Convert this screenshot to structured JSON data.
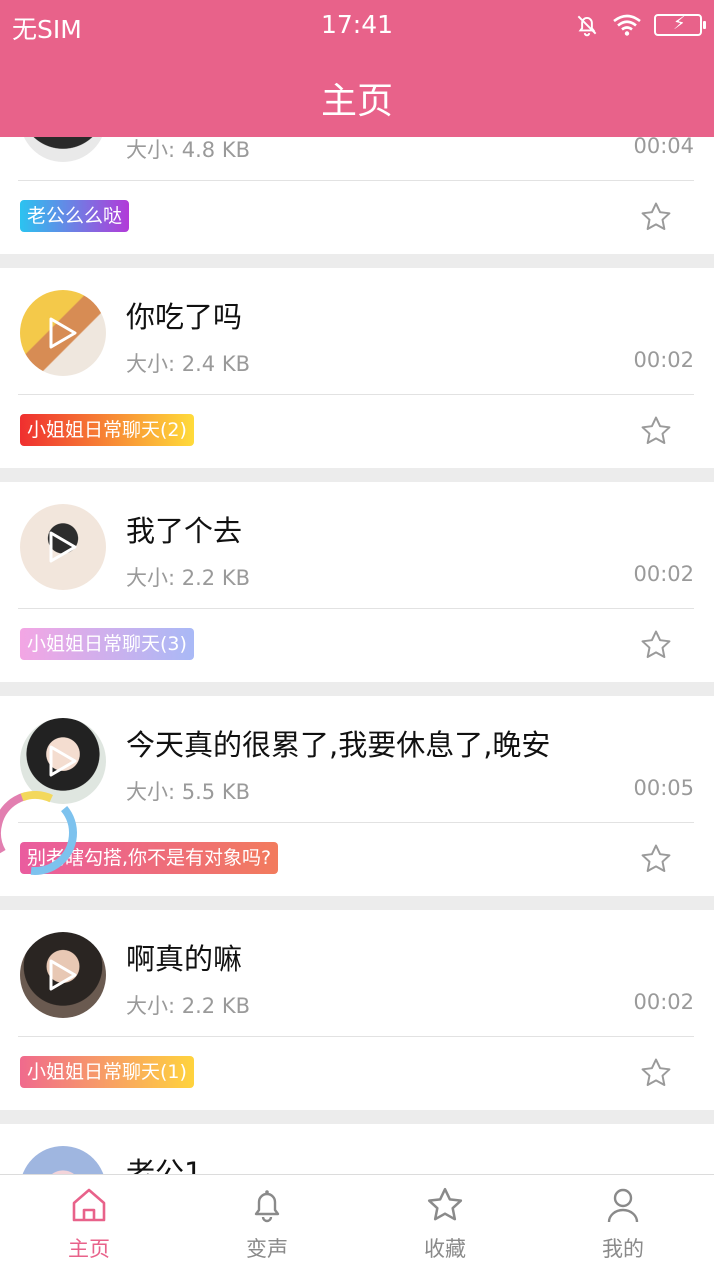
{
  "status": {
    "carrier": "无SIM",
    "time": "17:41"
  },
  "header": {
    "title": "主页"
  },
  "colors": {
    "brand": "#e8628a",
    "active_tab": "#e8628a"
  },
  "items": [
    {
      "name": "",
      "size": "大小: 4.8 KB",
      "duration": "00:04",
      "tag": "老公么么哒"
    },
    {
      "name": "你吃了吗",
      "size": "大小: 2.4 KB",
      "duration": "00:02",
      "tag": "小姐姐日常聊天(2)"
    },
    {
      "name": "我了个去",
      "size": "大小: 2.2 KB",
      "duration": "00:02",
      "tag": "小姐姐日常聊天(3)"
    },
    {
      "name": "今天真的很累了,我要休息了,晚安",
      "size": "大小: 5.5 KB",
      "duration": "00:05",
      "tag": "别老瞎勾搭,你不是有对象吗?"
    },
    {
      "name": "啊真的嘛",
      "size": "大小: 2.2 KB",
      "duration": "00:02",
      "tag": "小姐姐日常聊天(1)"
    },
    {
      "name": "老公1"
    }
  ],
  "tabs": [
    {
      "label": "主页",
      "icon": "home-icon",
      "active": true
    },
    {
      "label": "变声",
      "icon": "bell-icon"
    },
    {
      "label": "收藏",
      "icon": "star-icon"
    },
    {
      "label": "我的",
      "icon": "user-icon"
    }
  ]
}
